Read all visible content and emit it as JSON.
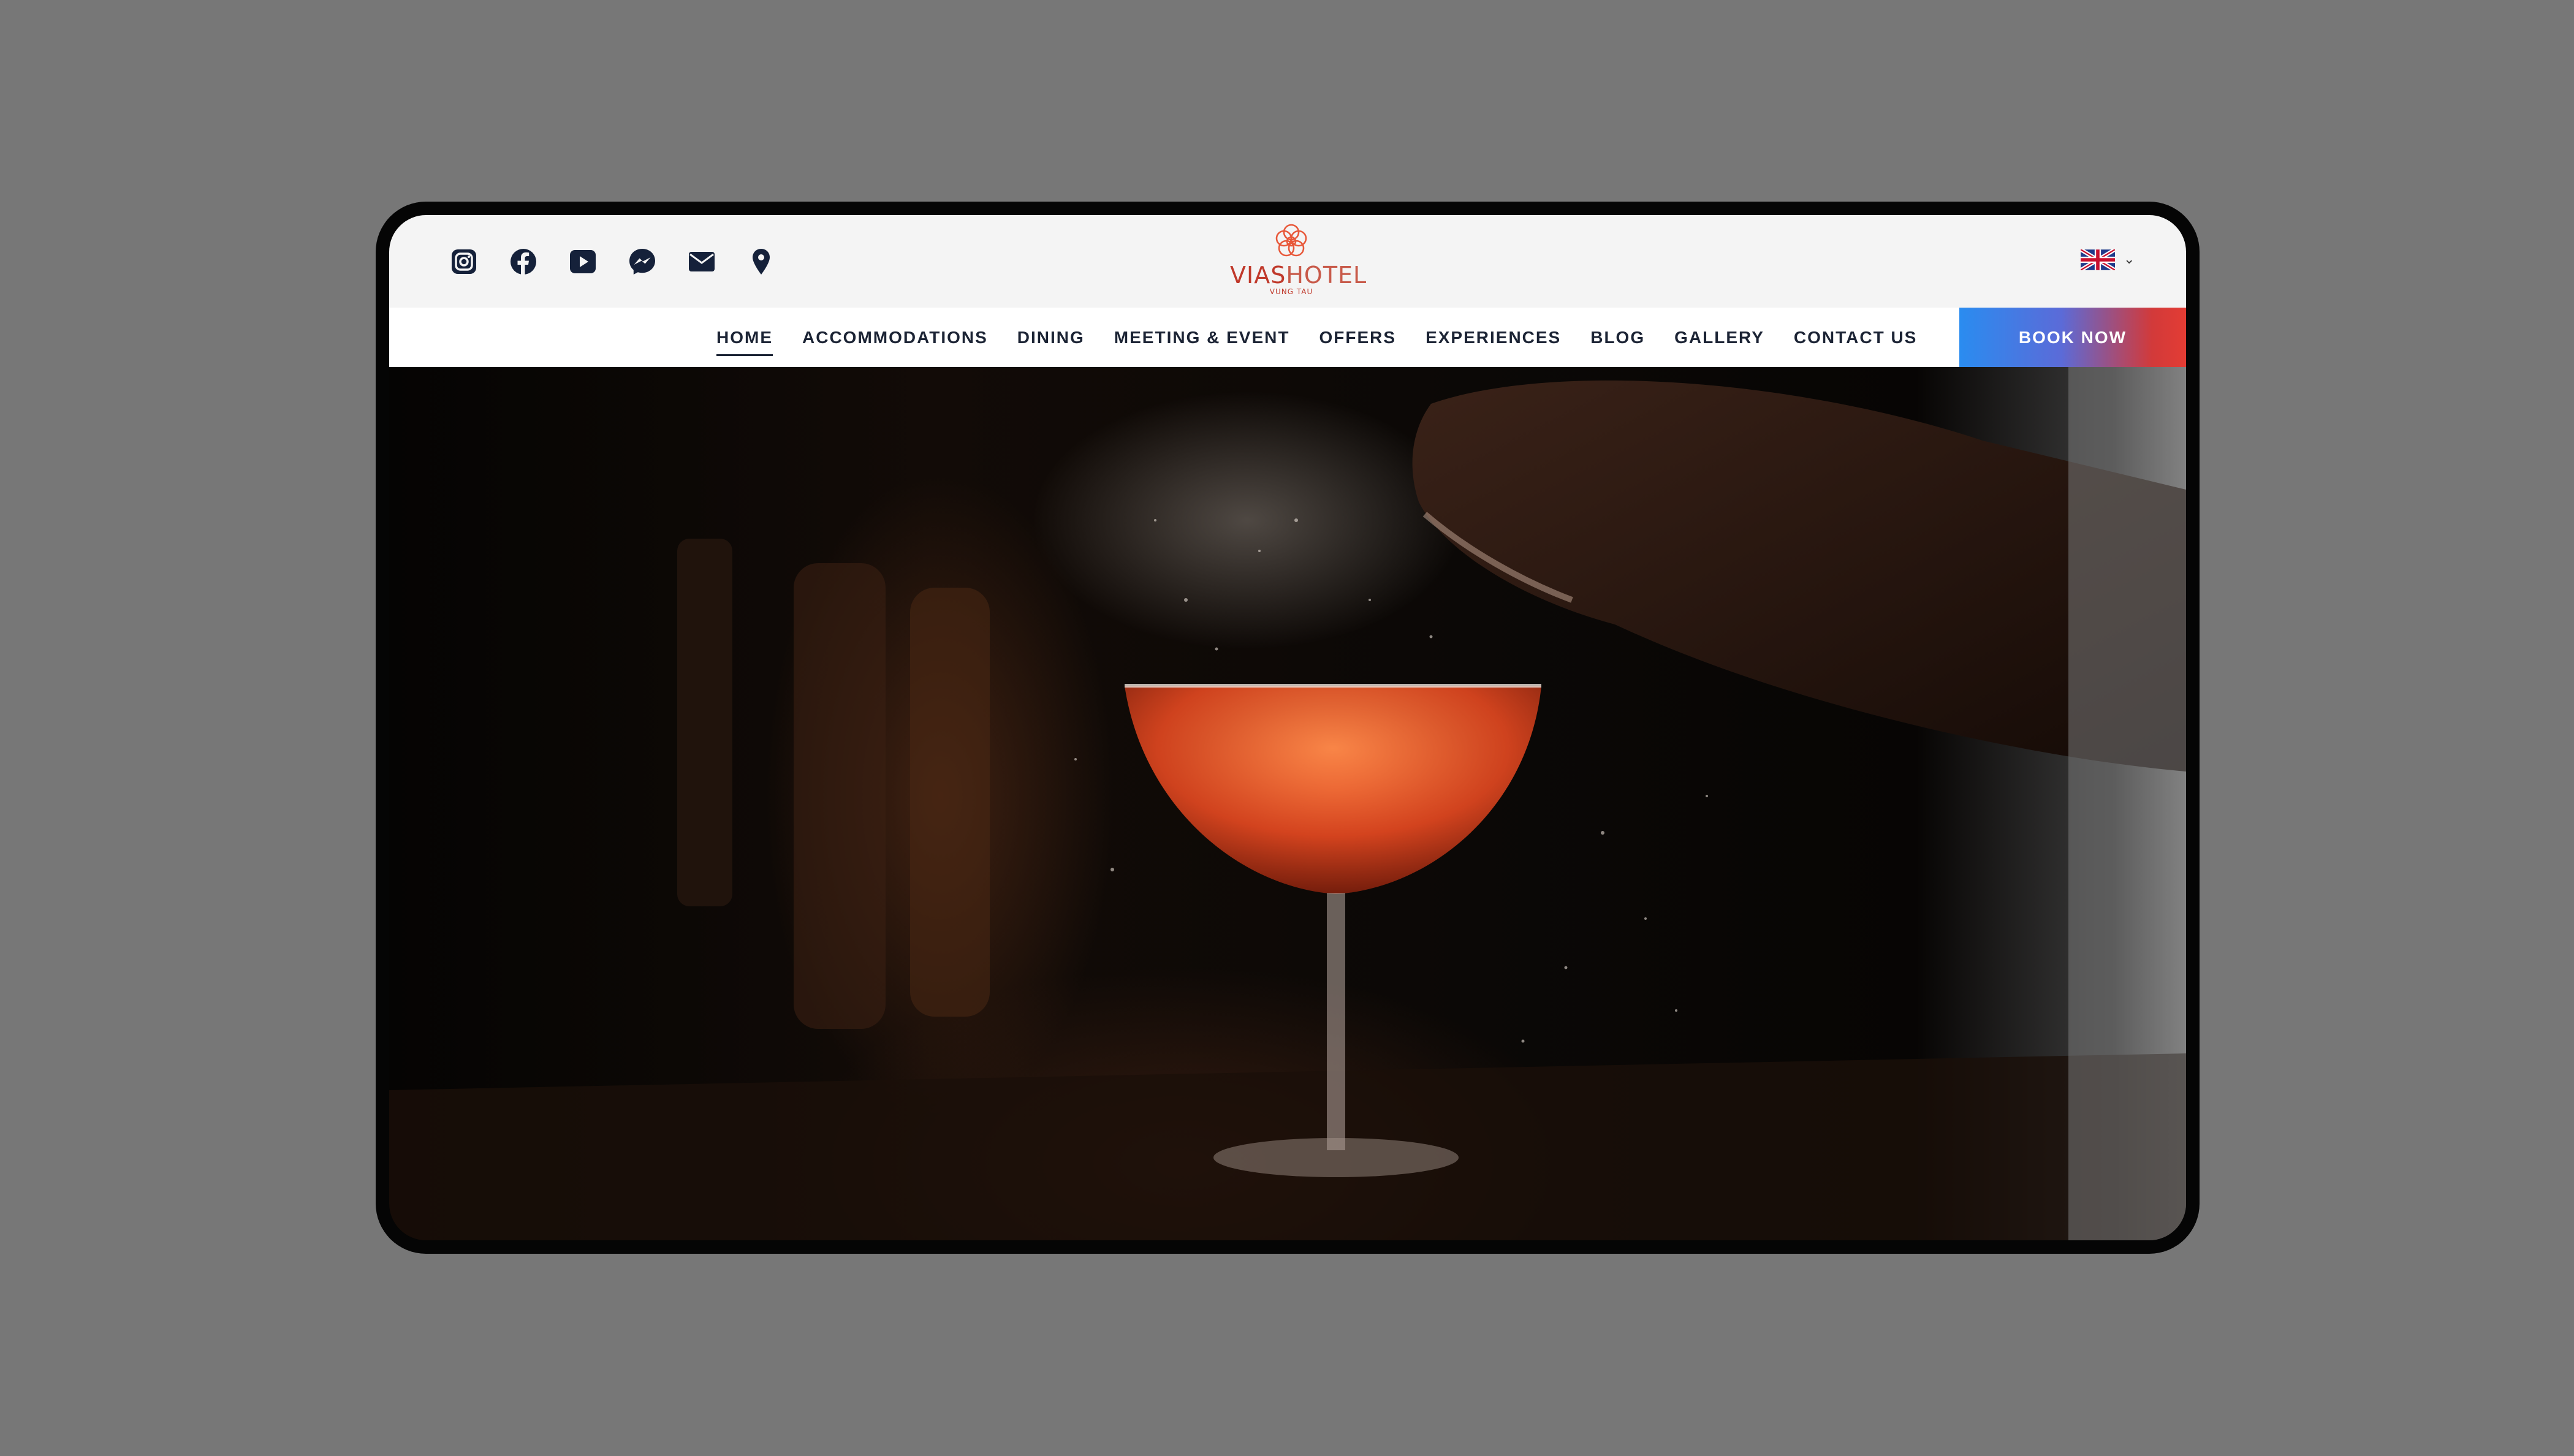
{
  "socials": [
    {
      "name": "instagram-icon"
    },
    {
      "name": "facebook-icon"
    },
    {
      "name": "youtube-icon"
    },
    {
      "name": "messenger-icon"
    },
    {
      "name": "email-icon"
    },
    {
      "name": "map-pin-icon"
    }
  ],
  "logo": {
    "brand_part1": "VIAS",
    "brand_part2": "HOTEL",
    "location": "VUNG TAU",
    "color": "#c0392b"
  },
  "language": {
    "selected": "English",
    "flag_icon": "uk-flag-icon"
  },
  "nav": {
    "items": [
      {
        "label": "HOME",
        "active": true
      },
      {
        "label": "ACCOMMODATIONS"
      },
      {
        "label": "DINING"
      },
      {
        "label": "MEETING & EVENT"
      },
      {
        "label": "OFFERS"
      },
      {
        "label": "EXPERIENCES"
      },
      {
        "label": "BLOG"
      },
      {
        "label": "GALLERY"
      },
      {
        "label": "CONTACT US"
      }
    ],
    "book_now": "BOOK NOW",
    "text_color": "#1b2334"
  },
  "hero": {
    "image": "cocktail-glass-being-sprayed-photo"
  }
}
